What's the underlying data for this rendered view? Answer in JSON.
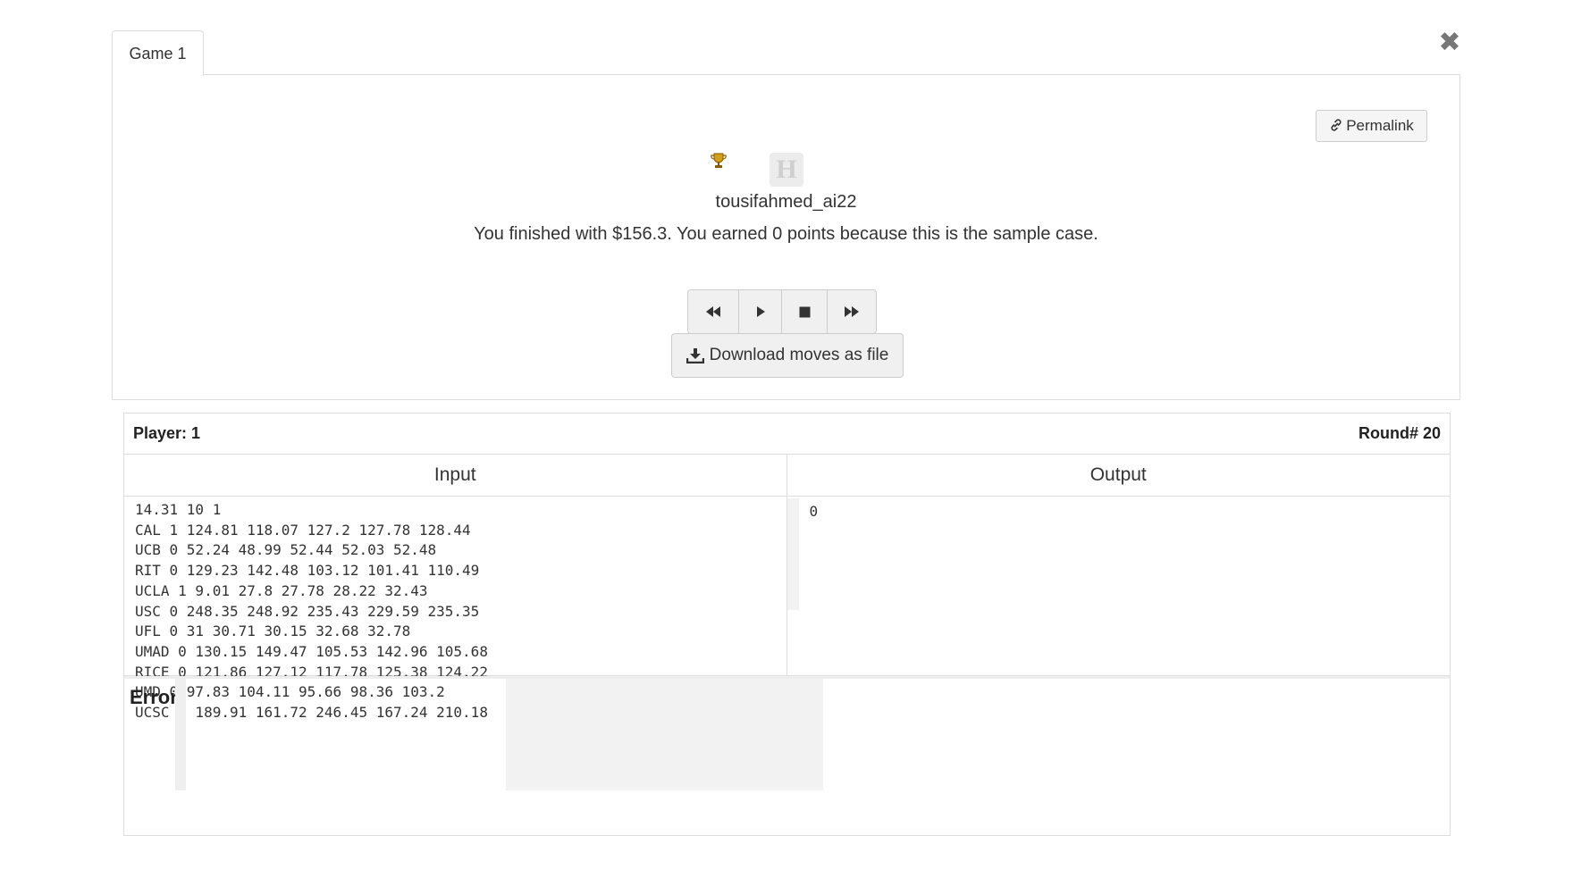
{
  "tab": {
    "label": "Game 1"
  },
  "close": {
    "glyph": "✖"
  },
  "permalink": {
    "label": "Permalink",
    "icon": "link-icon"
  },
  "player": {
    "username": "tousifahmed_ai22",
    "avatar_letter": "H",
    "trophy_icon": "trophy-icon"
  },
  "result_message": "You finished with $156.3. You earned 0 points because this is the sample case.",
  "playback": {
    "buttons": [
      {
        "name": "rewind-button",
        "icon": "rewind-icon"
      },
      {
        "name": "play-button",
        "icon": "play-icon"
      },
      {
        "name": "stop-button",
        "icon": "stop-icon"
      },
      {
        "name": "fast-forward-button",
        "icon": "fast-forward-icon"
      }
    ]
  },
  "download": {
    "label": "Download moves as file",
    "icon": "download-icon"
  },
  "section": {
    "player_label": "Player: 1",
    "round_label": "Round# 20",
    "input_title": "Input",
    "output_title": "Output",
    "input_lines": [
      "14.31 10 1",
      "CAL 1 124.81 118.07 127.2 127.78 128.44",
      "UCB 0 52.24 48.99 52.44 52.03 52.48",
      "RIT 0 129.23 142.48 103.12 101.41 110.49",
      "UCLA 1 9.01 27.8 27.78 28.22 32.43",
      "USC 0 248.35 248.92 235.43 229.59 235.35",
      "UFL 0 31 30.71 30.15 32.68 32.78",
      "UMAD 0 130.15 149.47 105.53 142.96 105.68",
      "RICE 0 121.86 127.12 117.78 125.38 124.22",
      "UMD 0 97.83 104.11 95.66 98.36 103.2",
      "UCSC 0 189.91 161.72 246.45 167.24 210.18"
    ],
    "output_text": "0",
    "error_label": "Error"
  }
}
